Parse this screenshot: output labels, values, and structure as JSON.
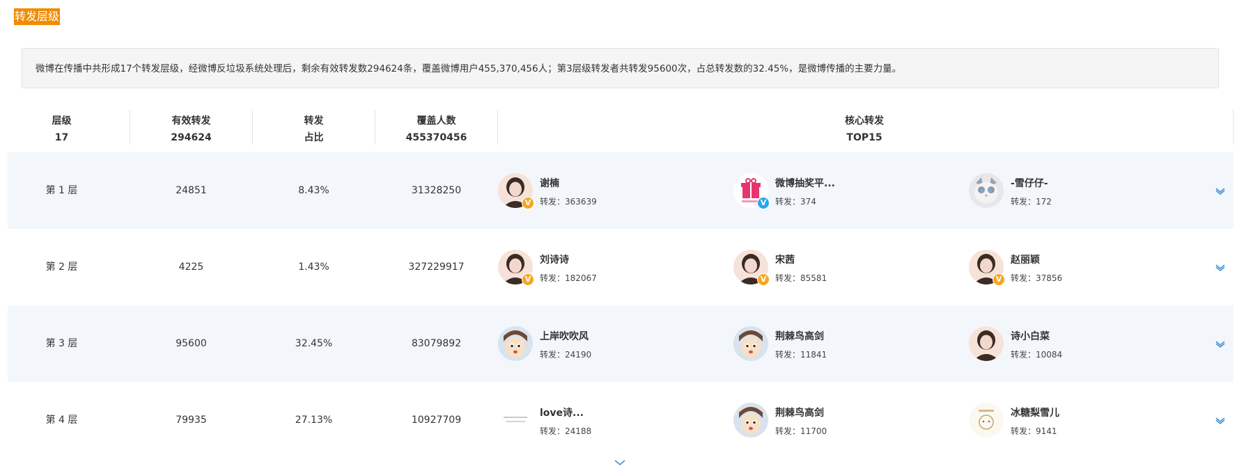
{
  "section": {
    "title": "转发层级"
  },
  "summary": {
    "text": "微博在传播中共形成17个转发层级，经微博反垃圾系统处理后，剩余有效转发数294624条，覆盖微博用户455,370,456人；第3层级转发者共转发95600次，占总转发数的32.45%，是微博传播的主要力量。"
  },
  "header": {
    "level": {
      "label": "层级",
      "value": "17"
    },
    "valid": {
      "label": "有效转发",
      "value": "294624"
    },
    "ratio": {
      "label": "转发",
      "value": "占比"
    },
    "coverage": {
      "label": "覆盖人数",
      "value": "455370456"
    },
    "core": {
      "label": "核心转发",
      "value": "TOP15"
    }
  },
  "rows": [
    {
      "level": "第 1 层",
      "valid": "24851",
      "ratio": "8.43%",
      "coverage": "31328250",
      "users": [
        {
          "name": "谢楠",
          "count": "转发：363639",
          "badge": "V",
          "badge_color": "gold",
          "avatar": "woman-icon"
        },
        {
          "name": "微博抽奖平...",
          "count": "转发：374",
          "badge": "V",
          "badge_color": "blue",
          "avatar": "gift-icon"
        },
        {
          "name": "-雪仔仔-",
          "count": "转发：172",
          "badge": "",
          "badge_color": "",
          "avatar": "cat-icon"
        }
      ]
    },
    {
      "level": "第 2 层",
      "valid": "4225",
      "ratio": "1.43%",
      "coverage": "327229917",
      "users": [
        {
          "name": "刘诗诗",
          "count": "转发：182067",
          "badge": "V",
          "badge_color": "gold",
          "avatar": "woman-icon"
        },
        {
          "name": "宋茜",
          "count": "转发：85581",
          "badge": "V",
          "badge_color": "gold",
          "avatar": "woman-icon"
        },
        {
          "name": "赵丽颖",
          "count": "转发：37856",
          "badge": "V",
          "badge_color": "gold",
          "avatar": "woman-icon"
        }
      ]
    },
    {
      "level": "第 3 层",
      "valid": "95600",
      "ratio": "32.45%",
      "coverage": "83079892",
      "users": [
        {
          "name": "上岸吹吹风",
          "count": "转发：24190",
          "badge": "",
          "badge_color": "",
          "avatar": "cartoon-icon"
        },
        {
          "name": "荆棘鸟高剑",
          "count": "转发：11841",
          "badge": "",
          "badge_color": "",
          "avatar": "cartoon-icon"
        },
        {
          "name": "诗小白菜",
          "count": "转发：10084",
          "badge": "",
          "badge_color": "",
          "avatar": "woman-icon"
        }
      ]
    },
    {
      "level": "第 4 层",
      "valid": "79935",
      "ratio": "27.13%",
      "coverage": "10927709",
      "users": [
        {
          "name": "love诗...",
          "count": "转发：24188",
          "badge": "",
          "badge_color": "",
          "avatar": "text-icon"
        },
        {
          "name": "荆棘鸟高剑",
          "count": "转发：11700",
          "badge": "",
          "badge_color": "",
          "avatar": "cartoon-icon"
        },
        {
          "name": "冰糖梨雪儿",
          "count": "转发：9141",
          "badge": "",
          "badge_color": "",
          "avatar": "sketch-icon"
        }
      ]
    }
  ],
  "colors": {
    "accent": "#f08a00",
    "row_alt": "#f3f7fc",
    "link": "#3a8fd8"
  }
}
